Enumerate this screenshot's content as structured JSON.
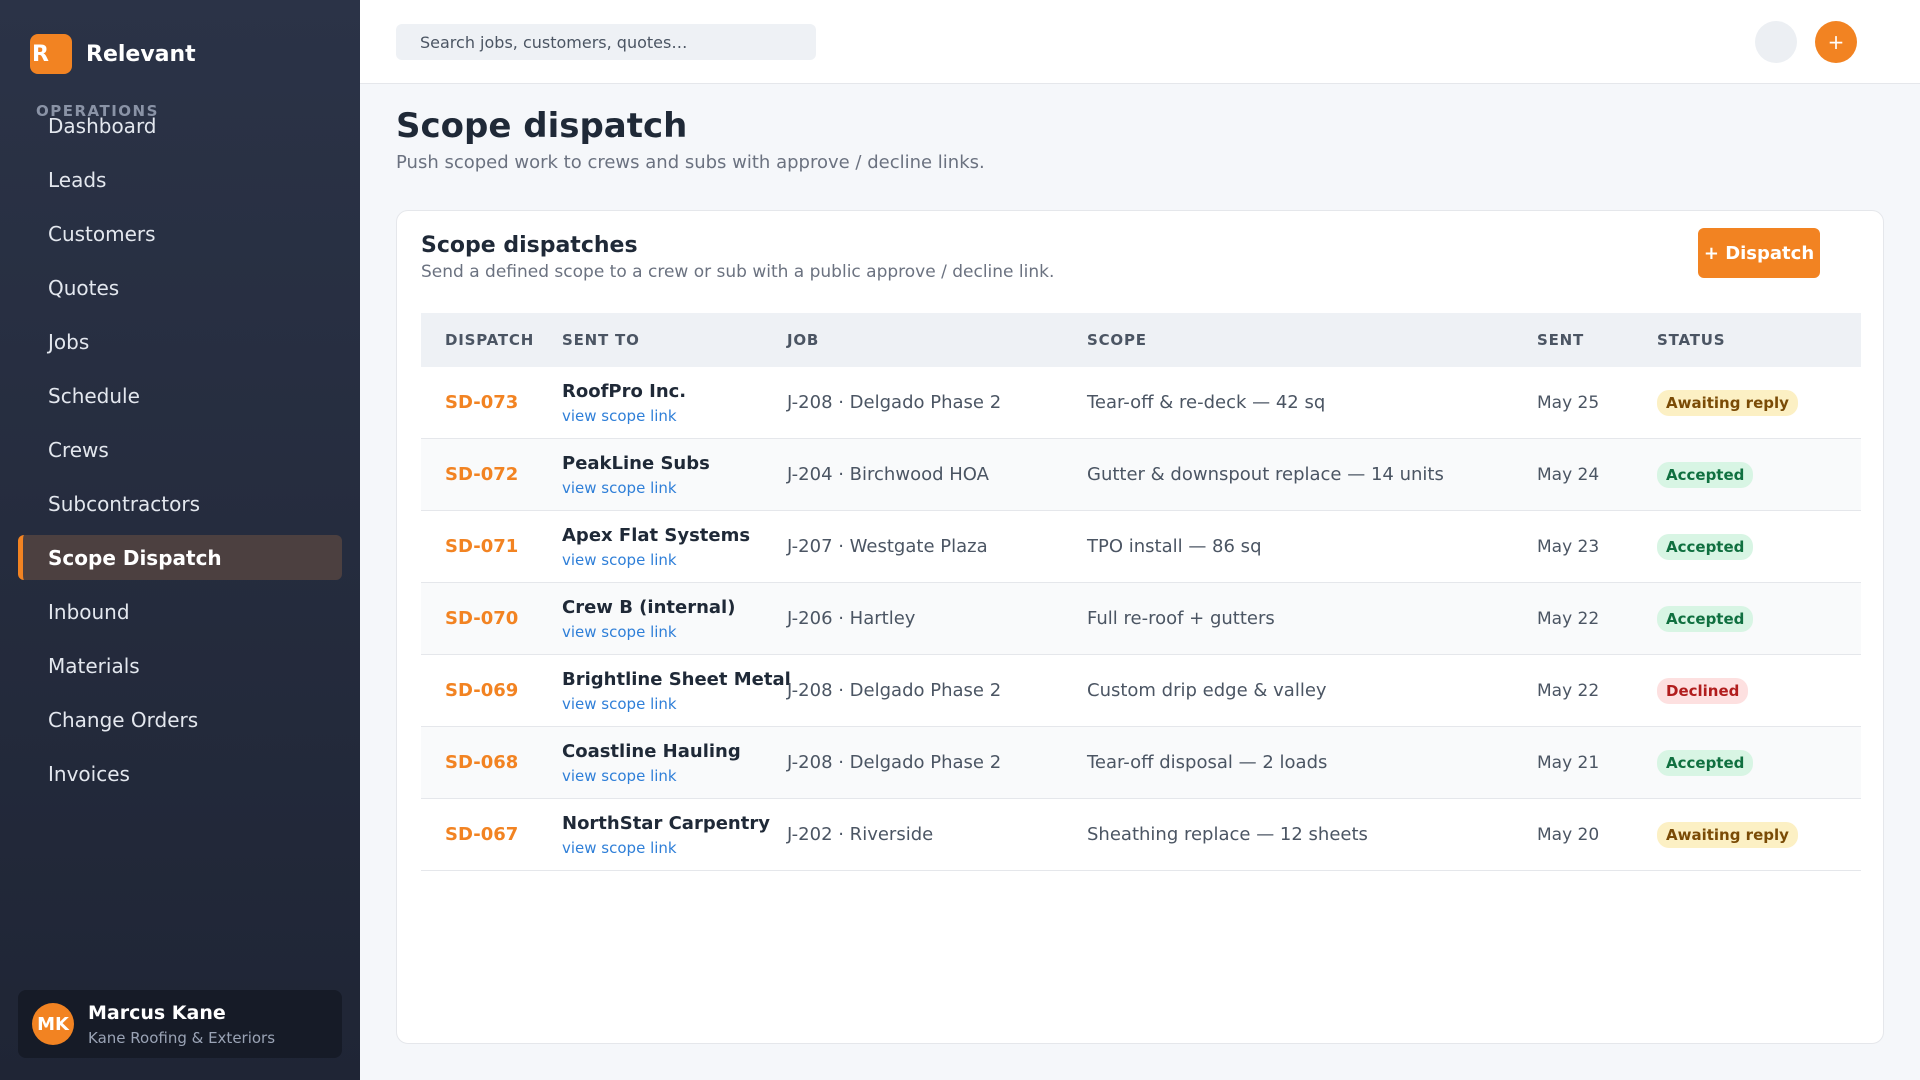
{
  "brand": {
    "logo_letter": "R",
    "name": "Relevant"
  },
  "sidebar": {
    "section_label": "OPERATIONS",
    "items": [
      {
        "label": "Dashboard",
        "slug": "dashboard"
      },
      {
        "label": "Leads",
        "slug": "leads"
      },
      {
        "label": "Customers",
        "slug": "customers"
      },
      {
        "label": "Quotes",
        "slug": "quotes"
      },
      {
        "label": "Jobs",
        "slug": "jobs"
      },
      {
        "label": "Schedule",
        "slug": "schedule"
      },
      {
        "label": "Crews",
        "slug": "crews"
      },
      {
        "label": "Subcontractors",
        "slug": "subcontractors"
      },
      {
        "label": "Scope Dispatch",
        "slug": "scope-dispatch",
        "active": true
      },
      {
        "label": "Inbound",
        "slug": "inbound"
      },
      {
        "label": "Materials",
        "slug": "materials"
      },
      {
        "label": "Change Orders",
        "slug": "change-orders"
      },
      {
        "label": "Invoices",
        "slug": "invoices"
      }
    ]
  },
  "user": {
    "initials": "MK",
    "name": "Marcus Kane",
    "org": "Kane Roofing & Exteriors"
  },
  "topbar": {
    "search_placeholder": "Search jobs, customers, quotes…",
    "add_label": "+"
  },
  "page": {
    "title": "Scope dispatch",
    "subtitle": "Push scoped work to crews and subs with approve / decline links."
  },
  "card": {
    "title": "Scope dispatches",
    "subtitle": "Send a defined scope to a crew or sub with a public approve / decline link.",
    "button_label": "+ Dispatch"
  },
  "table": {
    "columns": [
      "DISPATCH",
      "SENT TO",
      "JOB",
      "SCOPE",
      "SENT",
      "STATUS"
    ],
    "link_label": "view scope link",
    "rows": [
      {
        "id": "SD-073",
        "sent_to": "RoofPro Inc.",
        "job": "J-208 · Delgado Phase 2",
        "scope": "Tear-off & re-deck — 42 sq",
        "sent": "May 25",
        "status": "Awaiting reply",
        "status_kind": "awaiting"
      },
      {
        "id": "SD-072",
        "sent_to": "PeakLine Subs",
        "job": "J-204 · Birchwood HOA",
        "scope": "Gutter & downspout replace — 14 units",
        "sent": "May 24",
        "status": "Accepted",
        "status_kind": "accepted"
      },
      {
        "id": "SD-071",
        "sent_to": "Apex Flat Systems",
        "job": "J-207 · Westgate Plaza",
        "scope": "TPO install — 86 sq",
        "sent": "May 23",
        "status": "Accepted",
        "status_kind": "accepted"
      },
      {
        "id": "SD-070",
        "sent_to": "Crew B (internal)",
        "job": "J-206 · Hartley",
        "scope": "Full re-roof + gutters",
        "sent": "May 22",
        "status": "Accepted",
        "status_kind": "accepted"
      },
      {
        "id": "SD-069",
        "sent_to": "Brightline Sheet Metal",
        "job": "J-208 · Delgado Phase 2",
        "scope": "Custom drip edge & valley",
        "sent": "May 22",
        "status": "Declined",
        "status_kind": "declined"
      },
      {
        "id": "SD-068",
        "sent_to": "Coastline Hauling",
        "job": "J-208 · Delgado Phase 2",
        "scope": "Tear-off disposal — 2 loads",
        "sent": "May 21",
        "status": "Accepted",
        "status_kind": "accepted"
      },
      {
        "id": "SD-067",
        "sent_to": "NorthStar Carpentry",
        "job": "J-202 · Riverside",
        "scope": "Sheathing replace — 12 sheets",
        "sent": "May 20",
        "status": "Awaiting reply",
        "status_kind": "awaiting"
      }
    ]
  },
  "colors": {
    "accent": "#f28322",
    "sidebar_bg": "#2b3347",
    "link": "#2f7fd8"
  }
}
